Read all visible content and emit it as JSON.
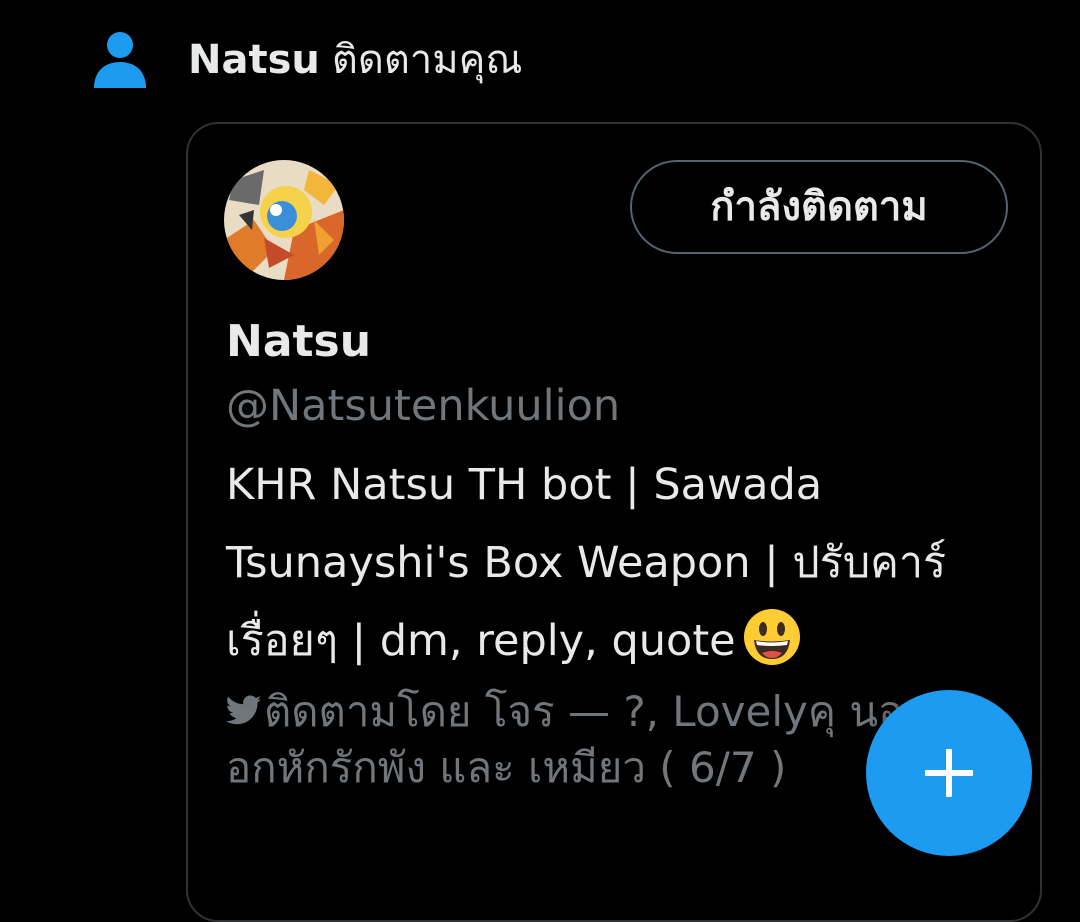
{
  "notification": {
    "icon": "person-icon",
    "name": "Natsu",
    "action_text": "ติดตามคุณ"
  },
  "user_card": {
    "avatar": "avatar-image",
    "follow_button_label": "กำลังติดตาม",
    "display_name": "Natsu",
    "handle": "@Natsutenkuulion",
    "bio_text": "KHR Natsu TH bot | Sawada Tsunayshi's Box Weapon | ปรับคาร์เรื่อยๆ | dm, reply, quote",
    "bio_emoji": "grinning-face-emoji",
    "followed_by_icon": "twitter-bird-icon",
    "followed_by_text": "ติดตามโดย โจร — ?, Lovelyคุ นอน |อกหักรักพัง และ เหมียว ( 6/7 )"
  },
  "fab": {
    "icon": "plus-icon"
  },
  "colors": {
    "background": "#000000",
    "primary_text": "#e7e9ea",
    "secondary_text": "#71767b",
    "accent": "#1d9bf0",
    "border": "#2f3336"
  }
}
